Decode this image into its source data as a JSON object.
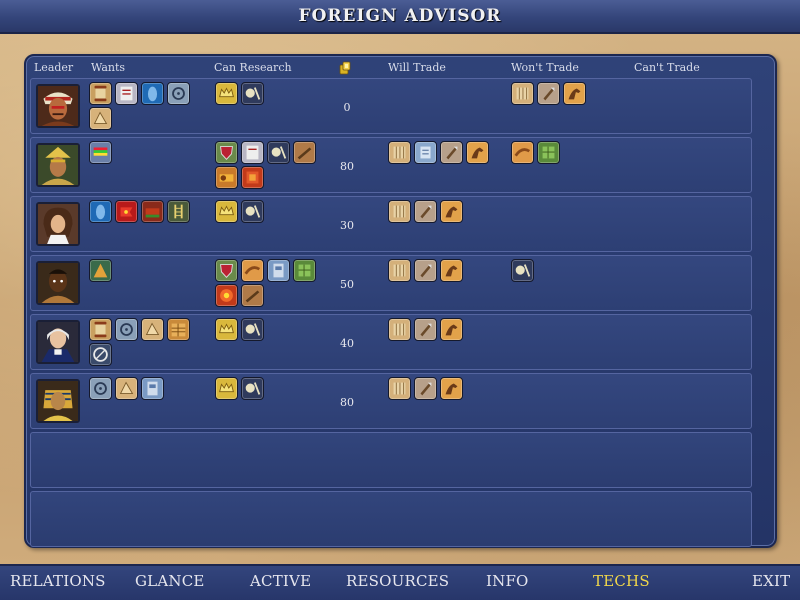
{
  "title": "FOREIGN ADVISOR",
  "columns": {
    "leader": "Leader",
    "wants": "Wants",
    "can_research": "Can Research",
    "will_trade": "Will Trade",
    "wont_trade": "Won't Trade",
    "cant_trade": "Can't Trade"
  },
  "rows": [
    {
      "gold": "0",
      "portrait": "iroquois-leader"
    },
    {
      "gold": "80",
      "portrait": "aztec-leader"
    },
    {
      "gold": "30",
      "portrait": "french-leader"
    },
    {
      "gold": "50",
      "portrait": "zulu-leader"
    },
    {
      "gold": "40",
      "portrait": "english-leader"
    },
    {
      "gold": "80",
      "portrait": "egyptian-leader"
    }
  ],
  "tech_icons": {
    "wants": [
      [
        "scroll-tech-icon",
        "writing-tech-icon",
        "ceremonial-tech-icon",
        "wheel-tech-icon",
        "tablet-tech-icon"
      ],
      [
        "colors-tech-icon"
      ],
      [
        "ceremonial-tech-icon",
        "flag-tech-icon",
        "cart-tech-icon",
        "ladder-tech-icon"
      ],
      [
        "pyramid-tech-icon"
      ],
      [
        "scroll-tech-icon",
        "wheel-tech-icon",
        "tablet-tech-icon",
        "masonry-tech-icon",
        "compass-tech-icon"
      ],
      [
        "wheel-tech-icon",
        "tablet-tech-icon",
        "throne-tech-icon"
      ]
    ],
    "can_research": [
      [
        "crown-tech-icon",
        "scales-tech-icon"
      ],
      [
        "shield-tech-icon",
        "writing-tech-icon",
        "scales-tech-icon",
        "spear-tech-icon",
        "gears-tech-icon",
        "fire-tech-icon"
      ],
      [
        "crown-tech-icon",
        "scales-tech-icon"
      ],
      [
        "shield-tech-icon",
        "spear-tech-icon",
        "throne-tech-icon",
        "map-tech-icon",
        "fire-tech-icon",
        "spear-tech-icon"
      ],
      [
        "crown-tech-icon",
        "scales-tech-icon"
      ],
      [
        "crown-tech-icon",
        "scales-tech-icon"
      ]
    ],
    "will_trade": [
      [],
      [
        "hands-tech-icon",
        "trade-tech-icon",
        "bronze-tech-icon",
        "horse-tech-icon"
      ],
      [
        "hands-tech-icon",
        "bronze-tech-icon",
        "horse-tech-icon"
      ],
      [
        "hands-tech-icon",
        "bronze-tech-icon",
        "horse-tech-icon"
      ],
      [
        "hands-tech-icon",
        "bronze-tech-icon",
        "horse-tech-icon"
      ],
      [
        "hands-tech-icon",
        "bronze-tech-icon",
        "horse-tech-icon"
      ]
    ],
    "wont_trade": [
      [
        "hands-tech-icon",
        "bronze-tech-icon",
        "horse-tech-icon"
      ],
      [
        "spear-tech-icon",
        "map-tech-icon"
      ],
      [],
      [
        "scales-tech-icon"
      ],
      [],
      []
    ]
  },
  "nav": {
    "relations": "RELATIONS",
    "glance": "GLANCE",
    "active": "ACTIVE",
    "resources": "RESOURCES",
    "info": "INFO",
    "techs": "TECHS",
    "exit": "EXIT"
  },
  "colors": {
    "active_tab": "#f0d64a",
    "panel": "#2f4278",
    "parchment": "#c9a676"
  }
}
